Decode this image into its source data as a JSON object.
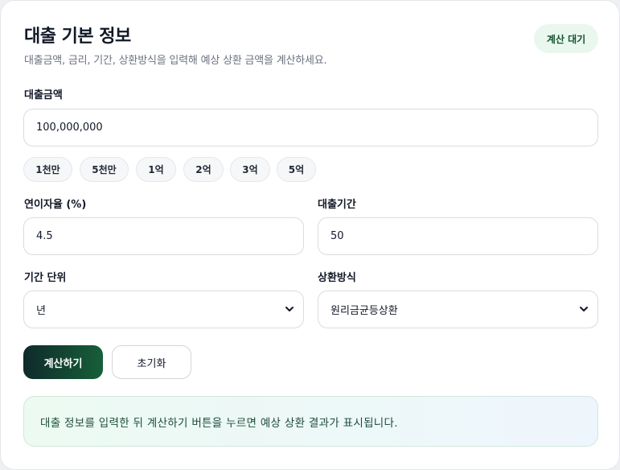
{
  "header": {
    "title": "대출 기본 정보",
    "subtitle": "대출금액, 금리, 기간, 상환방식을 입력해 예상 상환 금액을 계산하세요.",
    "status": "계산 대기"
  },
  "loan_amount": {
    "label": "대출금액",
    "value": "100,000,000",
    "presets": [
      "1천만",
      "5천만",
      "1억",
      "2억",
      "3억",
      "5억"
    ]
  },
  "interest_rate": {
    "label": "연이자율 (%)",
    "value": "4.5"
  },
  "loan_term": {
    "label": "대출기간",
    "value": "50"
  },
  "term_unit": {
    "label": "기간 단위",
    "selected": "년"
  },
  "repayment_method": {
    "label": "상환방식",
    "selected": "원리금균등상환"
  },
  "actions": {
    "calculate": "계산하기",
    "reset": "초기화"
  },
  "result": {
    "message": "대출 정보를 입력한 뒤 계산하기 버튼을 누르면 예상 상환 결과가 표시됩니다."
  },
  "colors": {
    "primary_start": "#0f2a2b",
    "primary_end": "#175f3a",
    "status_bg": "#e9f7ef",
    "status_text": "#14532d"
  }
}
